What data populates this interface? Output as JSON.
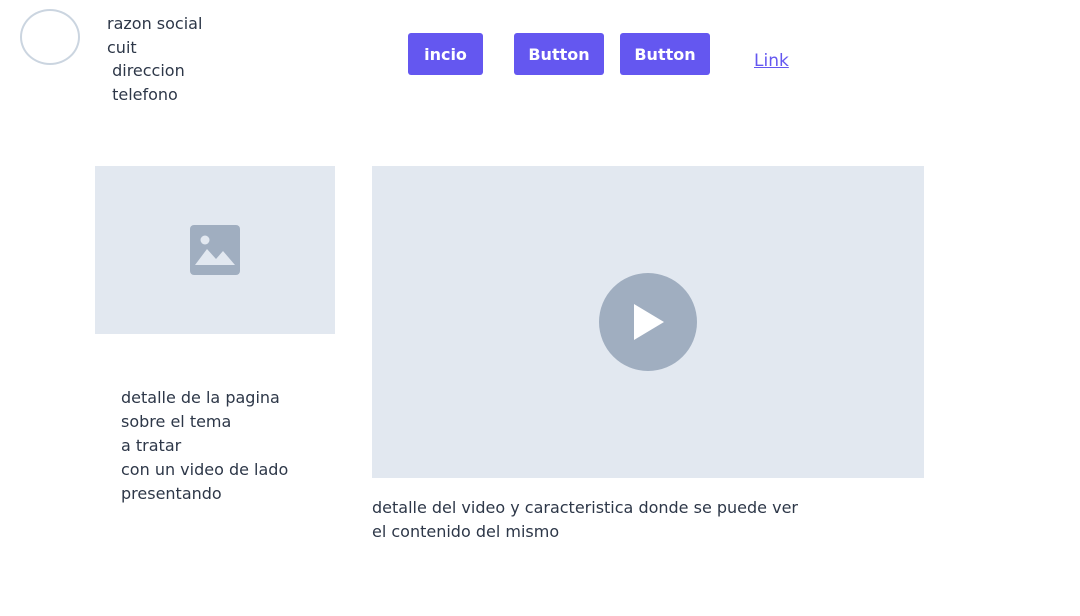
{
  "header": {
    "company": {
      "razon_social": "razon social",
      "cuit": "cuit",
      "direccion": " direccion",
      "telefono": " telefono"
    },
    "nav": {
      "inicio_label": "incio",
      "button1_label": "Button",
      "button2_label": "Button",
      "link_label": "Link"
    }
  },
  "main": {
    "image_icon": "image-icon",
    "page_detail": [
      "detalle de la pagina",
      "sobre el tema",
      "a tratar",
      "con un video de lado",
      "presentando"
    ],
    "video_icon": "play-icon",
    "video_detail": [
      "detalle del video y caracteristica donde se puede ver",
      "el contenido del mismo"
    ]
  },
  "colors": {
    "accent": "#6457f0",
    "placeholder_bg": "#e2e8f0",
    "placeholder_icon": "#a0aec0",
    "text": "#2d3748",
    "logo_border": "#cbd5e0"
  }
}
